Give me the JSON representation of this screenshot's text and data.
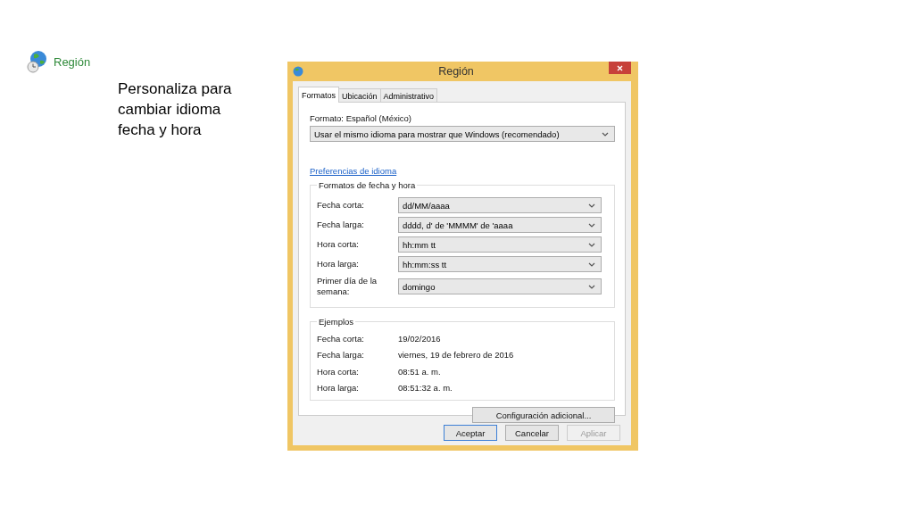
{
  "slide": {
    "app_label": "Región",
    "caption": "Personaliza para\ncambiar idioma\nfecha y hora"
  },
  "dialog": {
    "title": "Región",
    "tabs": [
      {
        "label": "Formatos",
        "selected": true
      },
      {
        "label": "Ubicación",
        "selected": false
      },
      {
        "label": "Administrativo",
        "selected": false
      }
    ],
    "format_label": "Formato: Español (México)",
    "format_select": "Usar el mismo idioma para mostrar que Windows (recomendado)",
    "link": "Preferencias de idioma",
    "formats_group": {
      "title": "Formatos de fecha y hora",
      "rows": [
        {
          "label": "Fecha corta:",
          "value": "dd/MM/aaaa"
        },
        {
          "label": "Fecha larga:",
          "value": "dddd, d' de 'MMMM' de 'aaaa"
        },
        {
          "label": "Hora corta:",
          "value": "hh:mm tt"
        },
        {
          "label": "Hora larga:",
          "value": "hh:mm:ss tt"
        },
        {
          "label": "Primer día de la\nsemana:",
          "value": "domingo"
        }
      ]
    },
    "examples_group": {
      "title": "Ejemplos",
      "rows": [
        {
          "label": "Fecha corta:",
          "value": "19/02/2016"
        },
        {
          "label": "Fecha larga:",
          "value": "viernes, 19 de febrero de 2016"
        },
        {
          "label": "Hora corta:",
          "value": "08:51 a. m."
        },
        {
          "label": "Hora larga:",
          "value": "08:51:32 a. m."
        }
      ]
    },
    "extra_button": "Configuración adicional...",
    "buttons": [
      {
        "label": "Aceptar",
        "default": true,
        "disabled": false
      },
      {
        "label": "Cancelar",
        "default": false,
        "disabled": false
      },
      {
        "label": "Aplicar",
        "default": false,
        "disabled": true
      }
    ]
  }
}
